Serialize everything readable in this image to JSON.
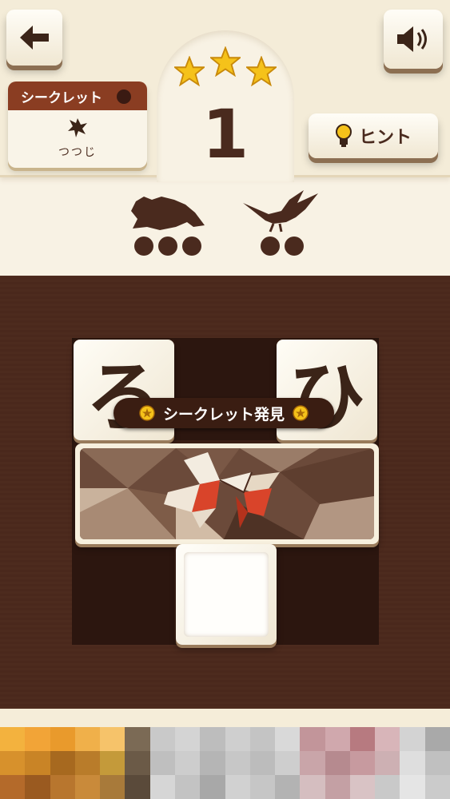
{
  "header": {
    "level_number": "1",
    "stars_earned": 3,
    "stars_total": 3,
    "hint_label": "ヒント"
  },
  "secret": {
    "title": "シークレット",
    "name": "つつじ",
    "icon": "azalea-flower-icon"
  },
  "targets": [
    {
      "icon": "frog-silhouette-icon",
      "letters": 3
    },
    {
      "icon": "crane-silhouette-icon",
      "letters": 2
    }
  ],
  "board": {
    "tiles": [
      "ろ",
      "ひ"
    ],
    "banner": "シークレット発見",
    "picture_icon": "azalea-stained-glass-icon"
  },
  "colors": {
    "dark_brown": "#4a2a1e",
    "ribbon": "#8a3d22",
    "star": "#f5c21a",
    "flower_red": "#d9442a"
  }
}
